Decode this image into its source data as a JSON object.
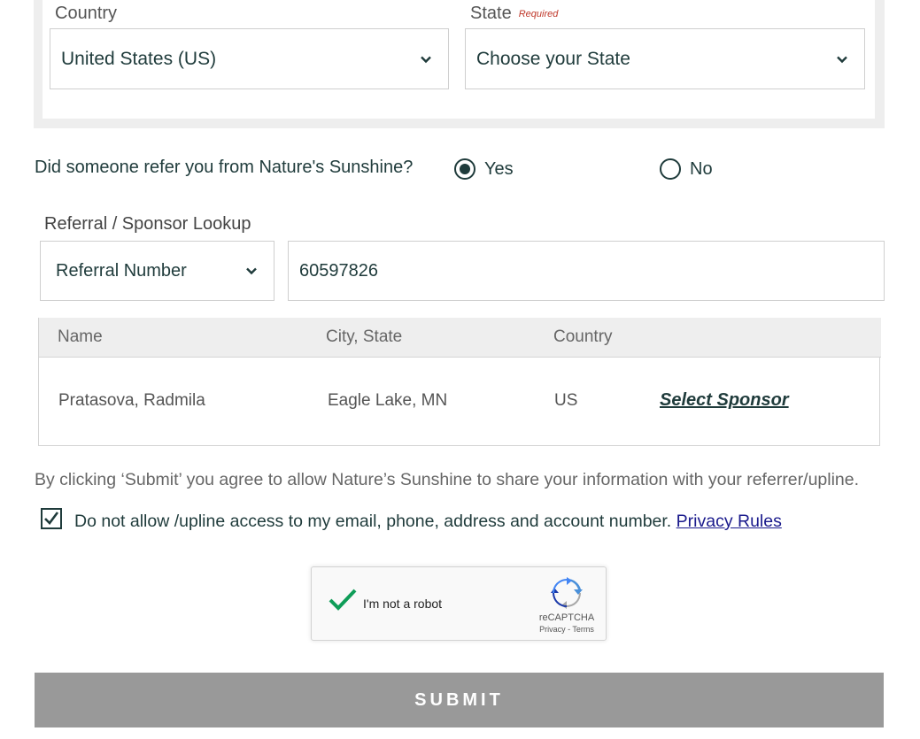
{
  "address": {
    "country_label": "Country",
    "country_value": "United States (US)",
    "state_label": "State",
    "state_required": "Required",
    "state_value": "Choose your State"
  },
  "referral": {
    "question": "Did someone refer you from Nature's Sunshine?",
    "yes_label": "Yes",
    "no_label": "No",
    "selected": "Yes"
  },
  "lookup": {
    "label": "Referral / Sponsor Lookup",
    "type_value": "Referral Number",
    "input_value": "60597826"
  },
  "results": {
    "headers": [
      "Name",
      "City, State",
      "Country"
    ],
    "rows": [
      {
        "name": "Pratasova, Radmila",
        "city_state": "Eagle Lake, MN",
        "country": "US",
        "action": "Select Sponsor"
      }
    ]
  },
  "consent": {
    "agree_text": "By clicking ‘Submit’ you agree to allow Nature’s Sunshine to share your information with your referrer/upline.",
    "optout_text": "Do not allow /upline access to my email, phone, address and account number.",
    "privacy_link": "Privacy Rules",
    "optout_checked": true
  },
  "captcha": {
    "label": "I'm not a robot",
    "brand": "reCAPTCHA",
    "terms": "Privacy - Terms",
    "checked": true
  },
  "submit_label": "SUBMIT",
  "colors": {
    "primary": "#1f3b3b",
    "panel_gray": "#eeeeee",
    "submit_gray": "#999999",
    "required_red": "#c0392b",
    "captcha_green": "#009688"
  }
}
